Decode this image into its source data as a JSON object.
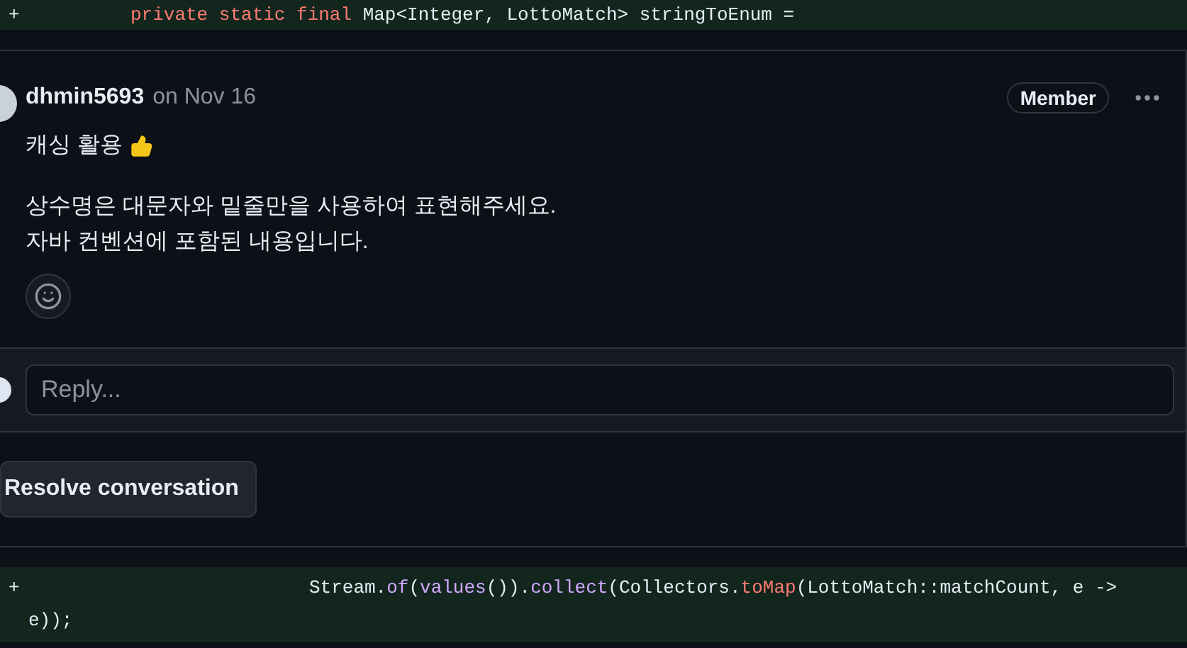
{
  "diff_top": {
    "marker": "+",
    "lines": [
      [
        {
          "text": "private static final",
          "kind": "keyword"
        },
        {
          "text": " Map<Integer, LottoMatch> stringToEnum =",
          "kind": "plain"
        }
      ]
    ]
  },
  "comment": {
    "author": "dhmin5693",
    "date": "on Nov 16",
    "role": "Member",
    "paragraphs": [
      "캐싱 활용",
      "상수명은 대문자와 밑줄만을 사용하여 표현해주세요.\n자바 컨벤션에 포함된 내용입니다."
    ]
  },
  "reply": {
    "placeholder": "Reply..."
  },
  "resolve_button": "Resolve conversation",
  "diff_bottom": {
    "marker": "+",
    "lines": [
      [
        {
          "text": "Stream.",
          "kind": "plain"
        },
        {
          "text": "of",
          "kind": "method"
        },
        {
          "text": "(",
          "kind": "plain"
        },
        {
          "text": "values",
          "kind": "method"
        },
        {
          "text": "()).",
          "kind": "plain"
        },
        {
          "text": "collect",
          "kind": "method"
        },
        {
          "text": "(Collectors.",
          "kind": "plain"
        },
        {
          "text": "toMap",
          "kind": "keyword"
        },
        {
          "text": "(LottoMatch::matchCount, e ->",
          "kind": "plain"
        }
      ],
      [
        {
          "text": "e));",
          "kind": "plain"
        }
      ]
    ]
  }
}
